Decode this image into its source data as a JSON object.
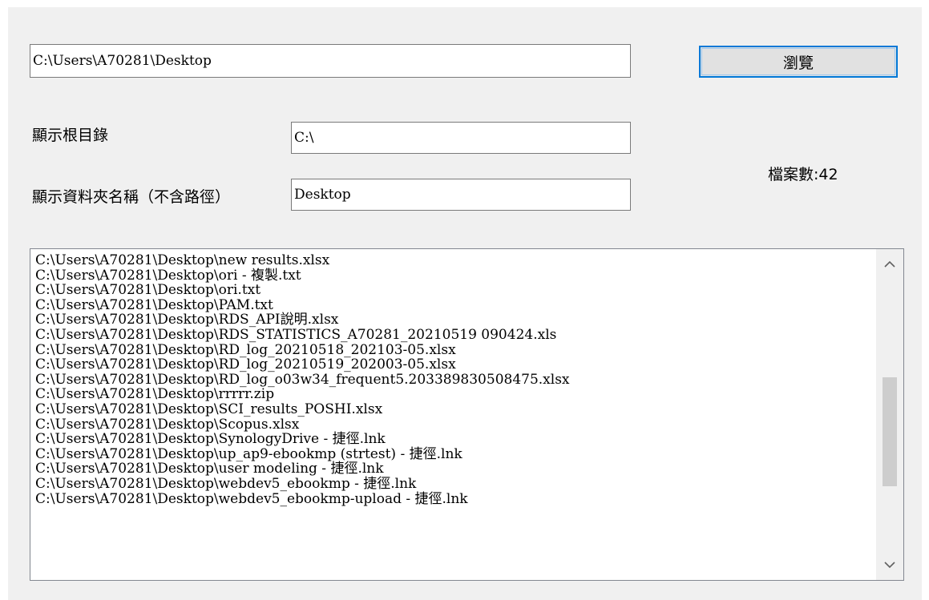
{
  "path_input": {
    "value": "C:\\Users\\A70281\\Desktop"
  },
  "browse_button": {
    "label": "瀏覽"
  },
  "root_dir": {
    "label": "顯示根目錄",
    "value": "C:\\"
  },
  "folder_name": {
    "label": "顯示資料夾名稱（不含路徑）",
    "value": "Desktop"
  },
  "file_count": {
    "text": "檔案數:42"
  },
  "file_list": {
    "items": [
      "C:\\Users\\A70281\\Desktop\\new results.xlsx",
      "C:\\Users\\A70281\\Desktop\\ori - 複製.txt",
      "C:\\Users\\A70281\\Desktop\\ori.txt",
      "C:\\Users\\A70281\\Desktop\\PAM.txt",
      "C:\\Users\\A70281\\Desktop\\RDS_API說明.xlsx",
      "C:\\Users\\A70281\\Desktop\\RDS_STATISTICS_A70281_20210519 090424.xls",
      "C:\\Users\\A70281\\Desktop\\RD_log_20210518_202103-05.xlsx",
      "C:\\Users\\A70281\\Desktop\\RD_log_20210519_202003-05.xlsx",
      "C:\\Users\\A70281\\Desktop\\RD_log_o03w34_frequent5.203389830508475.xlsx",
      "C:\\Users\\A70281\\Desktop\\rrrrr.zip",
      "C:\\Users\\A70281\\Desktop\\SCI_results_POSHI.xlsx",
      "C:\\Users\\A70281\\Desktop\\Scopus.xlsx",
      "C:\\Users\\A70281\\Desktop\\SynologyDrive - 捷徑.lnk",
      "C:\\Users\\A70281\\Desktop\\up_ap9-ebookmp (strtest) - 捷徑.lnk",
      "C:\\Users\\A70281\\Desktop\\user modeling - 捷徑.lnk",
      "C:\\Users\\A70281\\Desktop\\webdev5_ebookmp - 捷徑.lnk",
      "C:\\Users\\A70281\\Desktop\\webdev5_ebookmp-upload - 捷徑.lnk"
    ],
    "scroll_up_icon": "▲",
    "scroll_down_icon": "▼"
  }
}
